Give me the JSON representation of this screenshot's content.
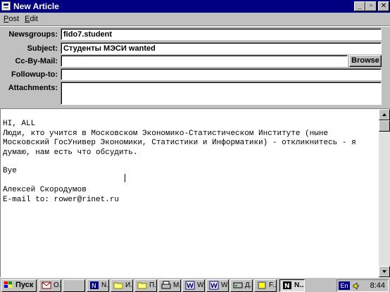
{
  "window": {
    "title": "New Article",
    "buttons": {
      "minimize": "_",
      "maximize": "▫",
      "close": "✕"
    }
  },
  "menu": [
    {
      "label": "Post",
      "underline": "P",
      "rest": "ost"
    },
    {
      "label": "Edit",
      "underline": "E",
      "rest": "dit"
    }
  ],
  "form": {
    "newsgroups_label": "Newsgroups:",
    "newsgroups_value": "fido7.student",
    "subject_label": "Subject:",
    "subject_value": "Студенты МЭСИ wanted",
    "cc_label": "Cc-By-Mail:",
    "cc_value": "",
    "browse_label": "Browse",
    "followup_label": "Followup-to:",
    "followup_value": "",
    "attachments_label": "Attachments:",
    "attachments_value": ""
  },
  "body": {
    "lines": [
      "HI, ALL",
      "Люди, кто учится в Московском Экономико-Статистическом Институте (ныне",
      "Московский ГосУнивер Экономики, Статистики и Информатики) - откликнитесь - я",
      "думаю, нам есть что обсудить.",
      "",
      "Bye",
      "",
      "Алексей Скородумов",
      "E-mail to: rower@rinet.ru"
    ]
  },
  "taskbar": {
    "start_label": "Пуск",
    "buttons": [
      {
        "label": "О...",
        "icon": "mail-icon"
      },
      {
        "label": "",
        "icon": "blank"
      },
      {
        "label": "N...",
        "icon": "netscape-icon"
      },
      {
        "label": "И...",
        "icon": "folder-icon"
      },
      {
        "label": "П...",
        "icon": "folder-icon"
      },
      {
        "label": "M...",
        "icon": "printer-icon"
      },
      {
        "label": "W...",
        "icon": "word-icon"
      },
      {
        "label": "W...",
        "icon": "word-icon"
      },
      {
        "label": "Д...",
        "icon": "disk-icon"
      },
      {
        "label": "F...",
        "icon": "ftp-icon"
      },
      {
        "label": "N...",
        "icon": "news-icon"
      }
    ],
    "tray": {
      "language": "En",
      "time": "8:44"
    }
  },
  "colors": {
    "titlebar": "#000080",
    "face": "#c0c0c0",
    "field": "#ffffff"
  }
}
